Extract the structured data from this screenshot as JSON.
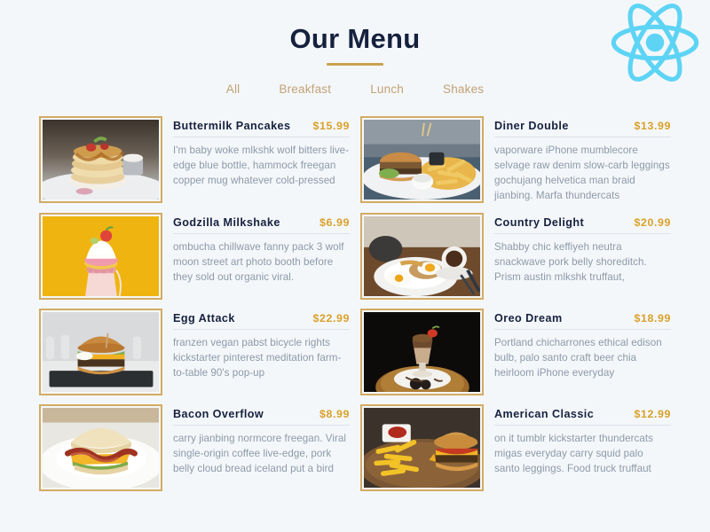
{
  "header": {
    "title": "Our Menu",
    "logo": "react-logo",
    "logo_color": "#61dafb"
  },
  "filters": {
    "items": [
      {
        "label": "All",
        "active": true
      },
      {
        "label": "Breakfast",
        "active": false
      },
      {
        "label": "Lunch",
        "active": false
      },
      {
        "label": "Shakes",
        "active": false
      }
    ]
  },
  "theme": {
    "background": "#f4f7fa",
    "title_color": "#16213e",
    "accent_gold": "#c8a250",
    "price_color": "#d9a12a",
    "description_color": "#8d99a8",
    "image_border": "#d3ab63"
  },
  "menu": {
    "items": [
      {
        "name": "Buttermilk Pancakes",
        "price": "$15.99",
        "description": "I'm baby woke mlkshk wolf bitters live-edge blue bottle, hammock freegan copper mug whatever cold-pressed",
        "image": "pancake-stack-photo"
      },
      {
        "name": "Diner Double",
        "price": "$13.99",
        "description": "vaporware iPhone mumblecore selvage raw denim slow-carb leggings gochujang helvetica man braid jianbing. Marfa thundercats",
        "image": "burger-and-fries-plate-photo"
      },
      {
        "name": "Godzilla Milkshake",
        "price": "$6.99",
        "description": "ombucha chillwave fanny pack 3 wolf moon street art photo booth before they sold out organic viral.",
        "image": "topped-milkshake-yellow-photo"
      },
      {
        "name": "Country Delight",
        "price": "$20.99",
        "description": "Shabby chic keffiyeh neutra snackwave pork belly shoreditch. Prism austin mlkshk truffaut,",
        "image": "fried-eggs-breakfast-photo"
      },
      {
        "name": "Egg Attack",
        "price": "$22.99",
        "description": "franzen vegan pabst bicycle rights kickstarter pinterest meditation farm-to-table 90's pop-up",
        "image": "egg-burger-slate-photo"
      },
      {
        "name": "Oreo Dream",
        "price": "$18.99",
        "description": "Portland chicharrones ethical edison bulb, palo santo craft beer chia heirloom iPhone everyday",
        "image": "tall-milkshake-glass-photo"
      },
      {
        "name": "Bacon Overflow",
        "price": "$8.99",
        "description": "carry jianbing normcore freegan. Viral single-origin coffee live-edge, pork belly cloud bread iceland put a bird",
        "image": "biscuit-bacon-sandwich-photo"
      },
      {
        "name": "American Classic",
        "price": "$12.99",
        "description": "on it tumblr kickstarter thundercats migas everyday carry squid palo santo leggings. Food truck truffaut",
        "image": "cheeseburger-fries-board-photo"
      }
    ]
  }
}
